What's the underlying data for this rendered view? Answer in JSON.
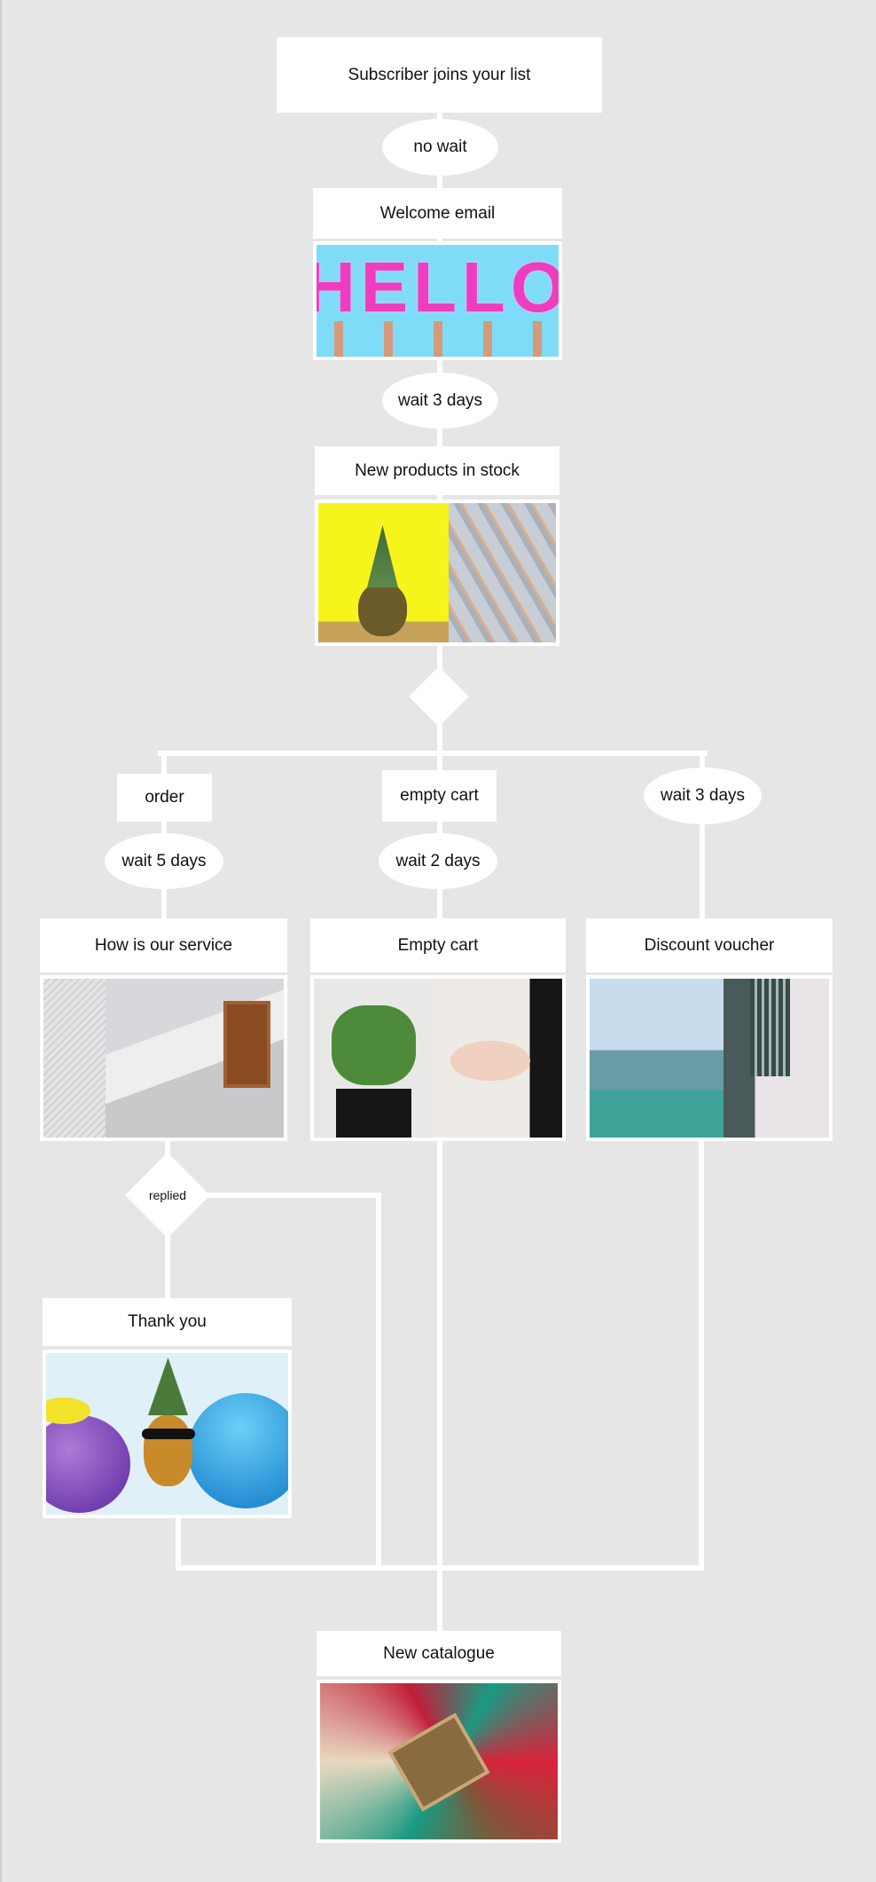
{
  "nodes": {
    "start": "Subscriber joins your list",
    "welcome": "Welcome email",
    "new_products": "New products in stock",
    "order_branch": "order",
    "empty_cart_branch": "empty cart",
    "service": "How is our service",
    "empty_cart": "Empty cart",
    "discount": "Discount voucher",
    "thank_you": "Thank you",
    "catalogue": "New catalogue"
  },
  "waits": {
    "no_wait": "no wait",
    "wait_3_days": "wait 3 days",
    "wait_3_days_right": "wait 3 days",
    "wait_5_days": "wait 5 days",
    "wait_2_days": "wait 2 days"
  },
  "decisions": {
    "replied": "replied"
  },
  "images": {
    "hello_lettering": "HELLO"
  },
  "colors": {
    "background": "#e6e6e6",
    "connector": "#ffffff",
    "node": "#ffffff"
  }
}
